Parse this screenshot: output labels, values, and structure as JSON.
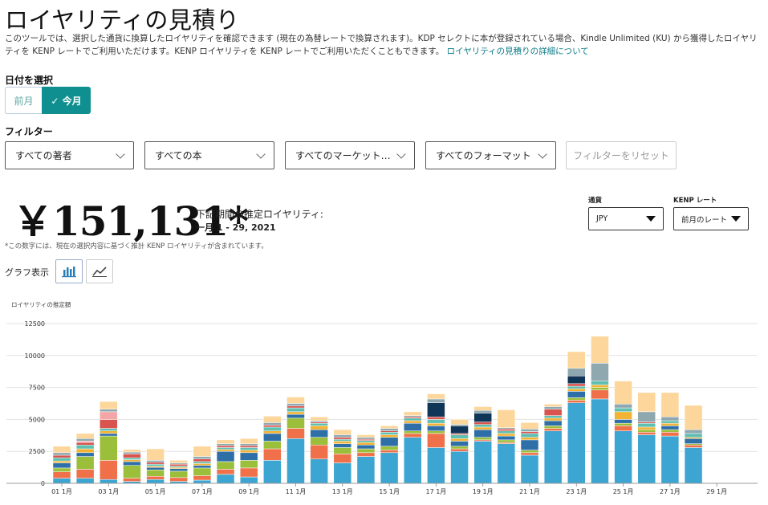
{
  "header": {
    "title": "ロイヤリティの見積り",
    "description": "このツールでは、選択した通貨に換算したロイヤリティを確認できます (現在の為替レートで換算されます)。KDP セレクトに本が登録されている場合、Kindle Unlimited (KU) から獲得したロイヤリティを KENP レートでご利用いただけます。KENP ロイヤリティを KENP レートでご利用いただくこともできます。",
    "details_link": "ロイヤリティの見積りの詳細について"
  },
  "date": {
    "label": "日付を選択",
    "prev_month": "前月",
    "this_month": "✓ 今月"
  },
  "filters": {
    "label": "フィルター",
    "authors": "すべての著者",
    "books": "すべての本",
    "markets": "すべてのマーケット…",
    "formats": "すべてのフォーマット",
    "reset": "フィルターをリセット"
  },
  "summary": {
    "amount": "￥151,131*",
    "label": "下記期間の推定ロイヤリティ:",
    "period": "一月 1 - 29, 2021",
    "footnote": "*この数字には、現在の選択内容に基づく推計 KENP ロイヤリティが含まれています。"
  },
  "currency": {
    "label": "通貨",
    "value": "JPY"
  },
  "kenp_rate": {
    "label": "KENP レート",
    "value": "前月のレート"
  },
  "graph": {
    "label": "グラフ表示",
    "bar_icon": "bar-chart-icon",
    "line_icon": "line-chart-icon"
  },
  "chart_data": {
    "type": "bar",
    "stacked": true,
    "ylabel": "ロイヤリティの推定額",
    "ylim": [
      0,
      12500
    ],
    "yticks": [
      0,
      2500,
      5000,
      7500,
      10000,
      12500
    ],
    "grid": true,
    "categories": [
      "01 1月",
      "02 1月",
      "03 1月",
      "04 1月",
      "05 1月",
      "06 1月",
      "07 1月",
      "08 1月",
      "09 1月",
      "10 1月",
      "11 1月",
      "12 1月",
      "13 1月",
      "14 1月",
      "15 1月",
      "16 1月",
      "17 1月",
      "18 1月",
      "19 1月",
      "20 1月",
      "21 1月",
      "22 1月",
      "23 1月",
      "24 1月",
      "25 1月",
      "26 1月",
      "27 1月",
      "28 1月",
      "29 1月"
    ],
    "xtick_labels": [
      "01 1月",
      "03 1月",
      "05 1月",
      "07 1月",
      "09 1月",
      "11 1月",
      "13 1月",
      "15 1月",
      "17 1月",
      "19 1月",
      "21 1月",
      "23 1月",
      "25 1月",
      "27 1月",
      "29 1月"
    ],
    "series": [
      {
        "color": "#3ca5d2",
        "values": [
          400,
          400,
          300,
          150,
          300,
          150,
          250,
          700,
          500,
          1800,
          3500,
          1900,
          1600,
          2100,
          2400,
          3600,
          2800,
          2500,
          3300,
          3100,
          2200,
          4100,
          6300,
          6600,
          4100,
          3800,
          3700,
          2800,
          0
        ]
      },
      {
        "color": "#f0704a",
        "values": [
          500,
          700,
          1500,
          250,
          250,
          300,
          350,
          400,
          700,
          900,
          800,
          1100,
          700,
          300,
          200,
          300,
          1100,
          200,
          100,
          100,
          200,
          200,
          200,
          700,
          400,
          200,
          300,
          200,
          0
        ]
      },
      {
        "color": "#9bbf3a",
        "values": [
          300,
          1000,
          1900,
          1000,
          500,
          500,
          600,
          600,
          600,
          600,
          800,
          600,
          500,
          300,
          300,
          200,
          200,
          200,
          200,
          200,
          200,
          200,
          200,
          200,
          200,
          200,
          200,
          100,
          0
        ]
      },
      {
        "color": "#2f6fa8",
        "values": [
          400,
          300,
          200,
          300,
          200,
          200,
          200,
          800,
          600,
          600,
          300,
          600,
          300,
          300,
          700,
          600,
          400,
          400,
          600,
          300,
          800,
          400,
          500,
          0,
          300,
          0,
          300,
          400,
          0
        ]
      },
      {
        "color": "#f2b233",
        "values": [
          150,
          300,
          200,
          150,
          100,
          100,
          150,
          150,
          200,
          200,
          200,
          300,
          200,
          200,
          200,
          200,
          200,
          200,
          200,
          200,
          200,
          200,
          200,
          200,
          600,
          200,
          200,
          100,
          0
        ]
      },
      {
        "color": "#5fbfb0",
        "values": [
          250,
          300,
          200,
          150,
          150,
          100,
          150,
          150,
          200,
          300,
          300,
          200,
          150,
          150,
          200,
          200,
          300,
          300,
          200,
          200,
          300,
          200,
          200,
          300,
          300,
          300,
          200,
          300,
          0
        ]
      },
      {
        "color": "#d9534f",
        "values": [
          200,
          200,
          700,
          300,
          150,
          150,
          200,
          150,
          150,
          150,
          150,
          100,
          150,
          100,
          100,
          100,
          200,
          100,
          200,
          150,
          150,
          500,
          200,
          0,
          0,
          100,
          0,
          0,
          0
        ]
      },
      {
        "color": "#0f3557",
        "values": [
          0,
          0,
          0,
          0,
          0,
          0,
          0,
          0,
          0,
          0,
          0,
          0,
          0,
          0,
          0,
          0,
          1100,
          600,
          700,
          0,
          0,
          0,
          600,
          0,
          0,
          0,
          0,
          0,
          0
        ]
      },
      {
        "color": "#f4a6a6",
        "values": [
          0,
          100,
          600,
          0,
          0,
          0,
          0,
          0,
          0,
          0,
          0,
          0,
          0,
          0,
          0,
          0,
          0,
          0,
          0,
          0,
          0,
          0,
          0,
          0,
          0,
          0,
          0,
          0,
          0
        ]
      },
      {
        "color": "#8fa8b0",
        "values": [
          200,
          200,
          200,
          150,
          150,
          100,
          200,
          150,
          150,
          200,
          200,
          100,
          200,
          150,
          200,
          100,
          300,
          100,
          200,
          100,
          200,
          200,
          600,
          1400,
          300,
          800,
          300,
          300,
          0
        ]
      },
      {
        "color": "#fcd69a",
        "values": [
          500,
          400,
          600,
          200,
          900,
          200,
          800,
          300,
          400,
          500,
          500,
          300,
          400,
          200,
          200,
          300,
          400,
          400,
          300,
          1400,
          500,
          200,
          1300,
          2100,
          1800,
          1500,
          1900,
          1900,
          0
        ]
      }
    ]
  }
}
